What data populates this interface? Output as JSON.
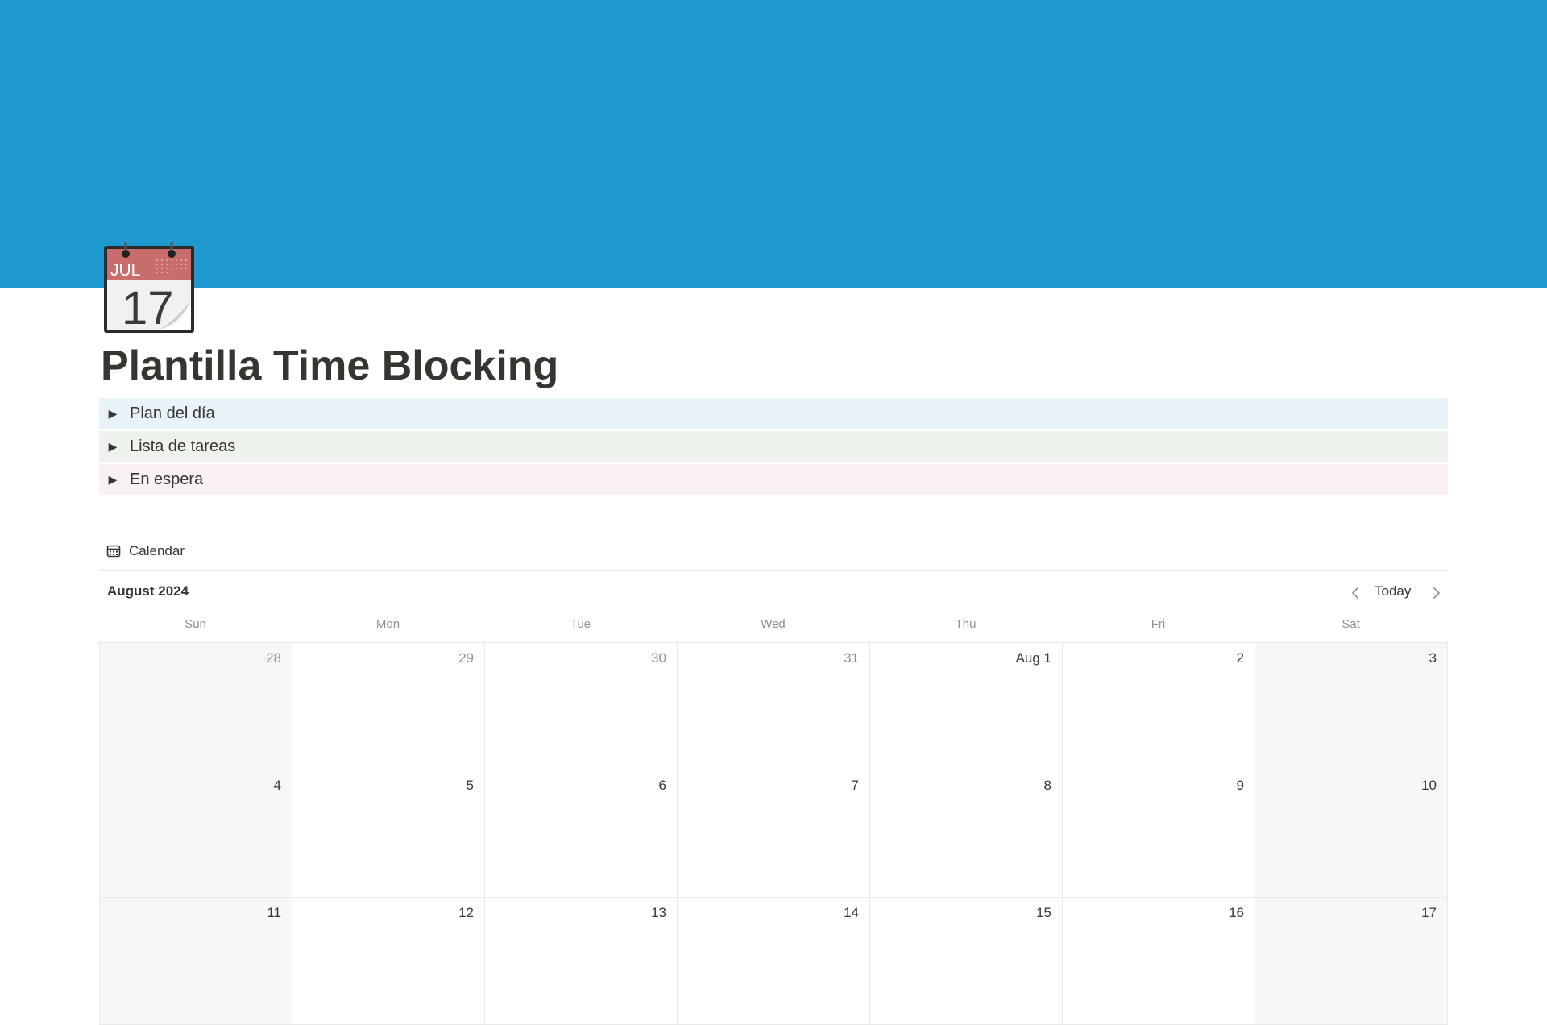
{
  "cover": {
    "color": "#1e9ad0"
  },
  "page": {
    "icon": "tear-off-calendar-icon",
    "icon_month": "JUL",
    "icon_day": "17",
    "title": "Plantilla Time Blocking"
  },
  "toggles": [
    {
      "label": "Plan del día",
      "background": "#e7f3f8"
    },
    {
      "label": "Lista de tareas",
      "background": "#edf3ec"
    },
    {
      "label": "En espera",
      "background": "#faf1f5"
    }
  ],
  "calendar": {
    "view_label": "Calendar",
    "view_icon": "calendar-view-icon",
    "month": "August 2024",
    "today_label": "Today",
    "weekdays": [
      "Sun",
      "Mon",
      "Tue",
      "Wed",
      "Thu",
      "Fri",
      "Sat"
    ],
    "weeks": [
      [
        "28",
        "29",
        "30",
        "31",
        "Aug 1",
        "2",
        "3"
      ],
      [
        "4",
        "5",
        "6",
        "7",
        "8",
        "9",
        "10"
      ],
      [
        "11",
        "12",
        "13",
        "14",
        "15",
        "16",
        "17"
      ]
    ],
    "other_month_cells": [
      "28",
      "29",
      "30",
      "31"
    ]
  }
}
